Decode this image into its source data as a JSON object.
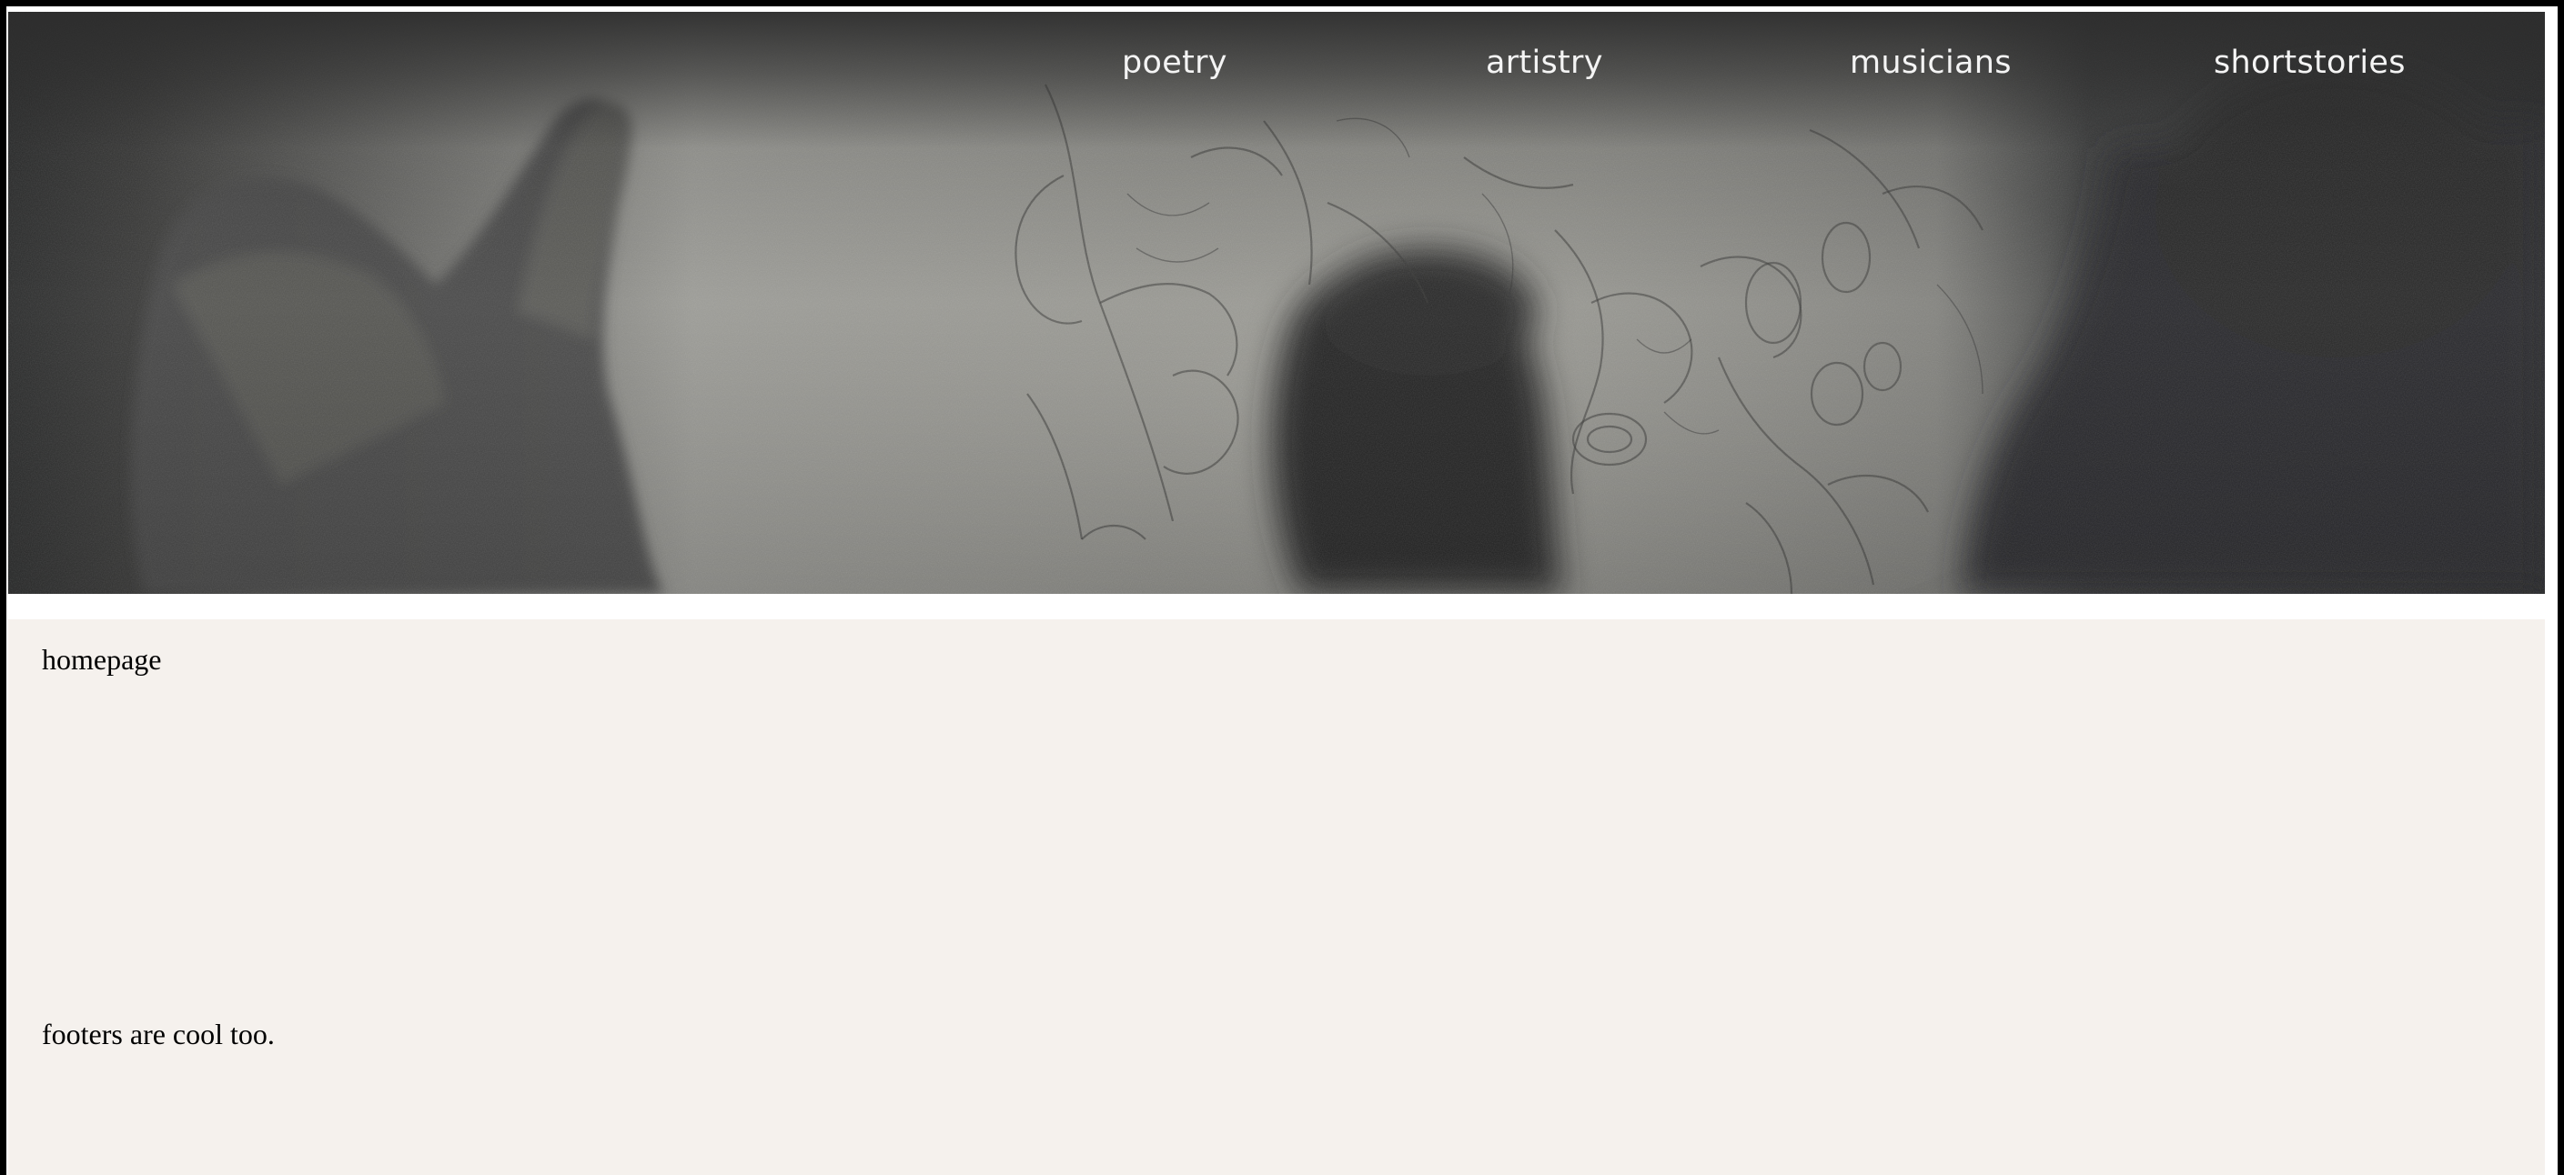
{
  "nav": {
    "items": [
      {
        "label": "poetry"
      },
      {
        "label": "artistry"
      },
      {
        "label": "musicians"
      },
      {
        "label": "shortstories"
      }
    ]
  },
  "hero": {
    "image": "grayscale photo of hands beside a floral line-art drawing"
  },
  "main": {
    "heading": "homepage"
  },
  "footer": {
    "text": "footers are cool too."
  },
  "colors": {
    "frame": "#000000",
    "page_background": "#ffffff",
    "content_background": "#f5f1ed",
    "nav_text": "#f4f4f4",
    "header_dark": "#2d2d2d"
  }
}
